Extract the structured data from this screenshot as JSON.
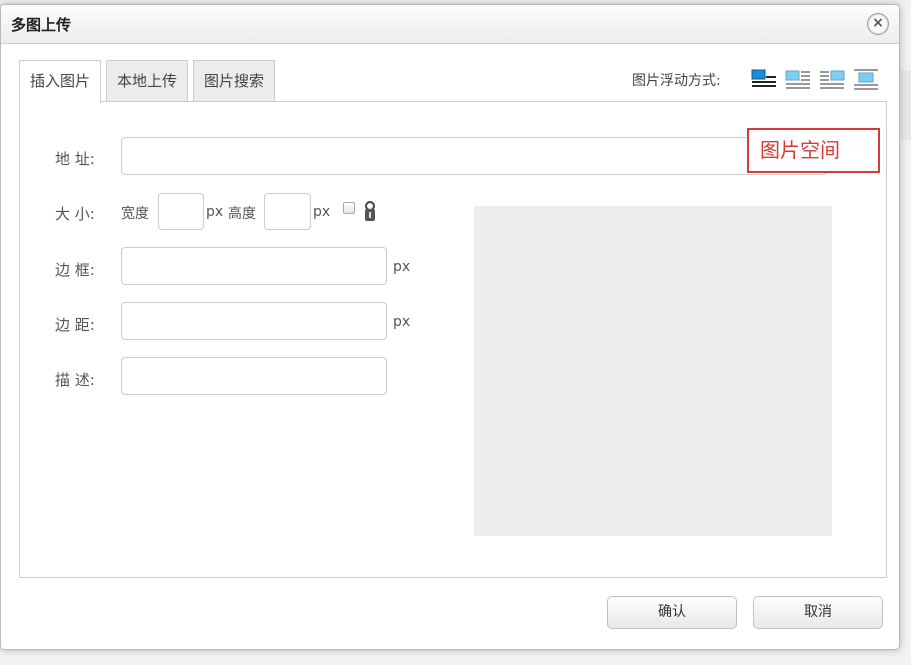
{
  "dialog": {
    "title": "多图上传"
  },
  "tabs": [
    {
      "label": "插入图片",
      "active": true
    },
    {
      "label": "本地上传",
      "active": false
    },
    {
      "label": "图片搜索",
      "active": false
    }
  ],
  "float": {
    "label": "图片浮动方式:",
    "options": [
      {
        "icon": "align-none-icon",
        "selected": true
      },
      {
        "icon": "align-left-icon",
        "selected": false
      },
      {
        "icon": "align-right-icon",
        "selected": false
      },
      {
        "icon": "align-center-icon",
        "selected": false
      }
    ]
  },
  "form": {
    "address_label": "地 址:",
    "address_value": "",
    "size_label": "大 小:",
    "width_label": "宽度",
    "width_value": "",
    "height_label": "高度",
    "height_value": "",
    "unit": "px",
    "border_label": "边 框:",
    "border_value": "",
    "margin_label": "边 距:",
    "margin_value": "",
    "desc_label": "描 述:",
    "desc_value": ""
  },
  "image_space_label": "图片空间",
  "buttons": {
    "confirm": "确认",
    "cancel": "取消"
  },
  "colors": {
    "accent_red": "#d83a35",
    "selected_icon": "#1a8fd6"
  }
}
